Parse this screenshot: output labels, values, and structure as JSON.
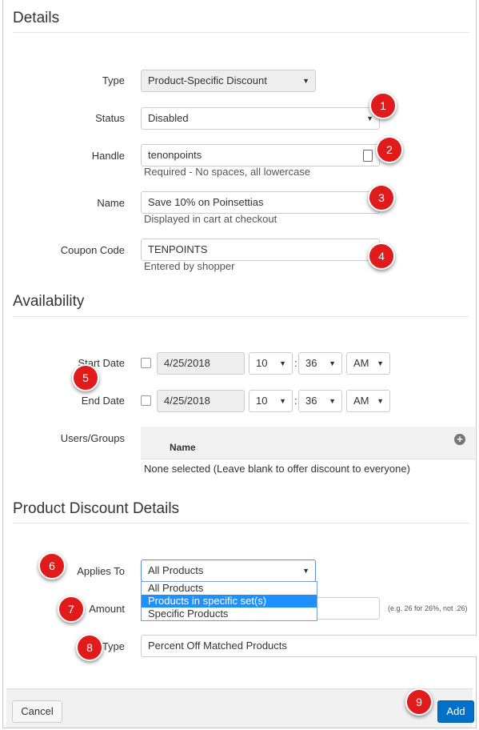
{
  "details": {
    "title": "Details",
    "type": {
      "label": "Type",
      "value": "Product-Specific Discount"
    },
    "status": {
      "label": "Status",
      "value": "Disabled"
    },
    "handle": {
      "label": "Handle",
      "value": "tenonpoints",
      "help": "Required - No spaces, all lowercase"
    },
    "name": {
      "label": "Name",
      "value": "Save 10% on Poinsettias",
      "help": "Displayed in cart at checkout"
    },
    "coupon": {
      "label": "Coupon Code",
      "value": "TENPOINTS",
      "help": "Entered by shopper"
    }
  },
  "availability": {
    "title": "Availability",
    "start": {
      "label": "Start Date",
      "date": "4/25/2018",
      "hour": "10",
      "sep": ":",
      "minute": "36",
      "ampm": "AM"
    },
    "end": {
      "label": "End Date",
      "date": "4/25/2018",
      "hour": "10",
      "sep": ":",
      "minute": "36",
      "ampm": "AM"
    },
    "users": {
      "label": "Users/Groups",
      "column": "Name",
      "empty": "None selected (Leave blank to offer discount to everyone)"
    }
  },
  "product_discount": {
    "title": "Product Discount Details",
    "applies_to": {
      "label": "Applies To",
      "value": "All Products",
      "options": [
        "All Products",
        "Products in specific set(s)",
        "Specific Products"
      ]
    },
    "amount": {
      "label": "Amount",
      "value": "",
      "help": "(e.g. 26 for 26%, not .26)"
    },
    "type": {
      "label": "Type",
      "value": "Percent Off Matched Products"
    }
  },
  "footer": {
    "cancel": "Cancel",
    "add": "Add"
  },
  "badges": [
    "1",
    "2",
    "3",
    "4",
    "5",
    "6",
    "7",
    "8",
    "9"
  ],
  "icons": {
    "caret": "▼",
    "plus": "+",
    "key": "⍗"
  },
  "colors": {
    "badge": "#e01b1b",
    "primary": "#0070c9",
    "selected_option": "#1e90ff"
  }
}
